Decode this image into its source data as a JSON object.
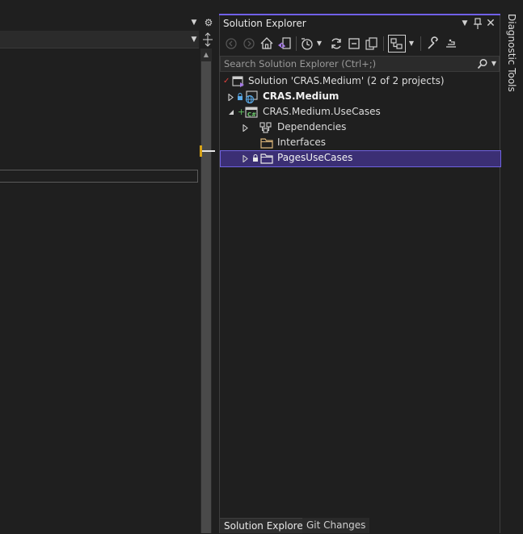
{
  "solution_explorer": {
    "title": "Solution Explorer",
    "search_placeholder": "Search Solution Explorer (Ctrl+;)",
    "tree": [
      {
        "label": "Solution 'CRAS.Medium' (2 of 2 projects)",
        "icon": "solution-icon"
      },
      {
        "label": "CRAS.Medium",
        "icon": "web-project-icon",
        "bold": true,
        "expanded": false
      },
      {
        "label": "CRAS.Medium.UseCases",
        "icon": "csharp-project-icon",
        "expanded": true
      },
      {
        "label": "Dependencies",
        "icon": "dependencies-icon",
        "expanded": false
      },
      {
        "label": "Interfaces",
        "icon": "folder-icon"
      },
      {
        "label": "PagesUseCases",
        "icon": "folder-icon",
        "selected": true,
        "expanded": false
      }
    ]
  },
  "bottom_tabs": [
    {
      "label": "Solution Explorer",
      "active": true
    },
    {
      "label": "Git Changes",
      "active": false
    }
  ],
  "side_tabs": [
    {
      "label": "Diagnostic Tools"
    }
  ],
  "colors": {
    "accent": "#7160e8",
    "selection": "#3b2f74",
    "background": "#1f1f1f"
  }
}
